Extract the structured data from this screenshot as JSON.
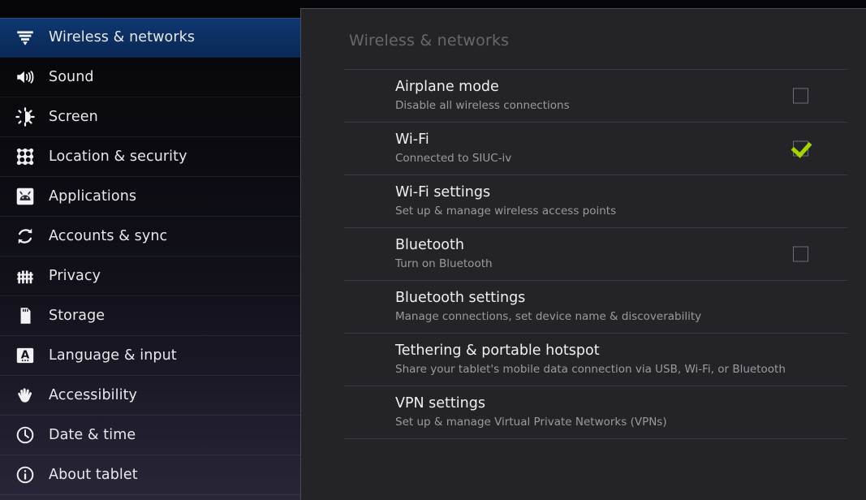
{
  "sidebar": {
    "items": [
      {
        "label": "Wireless & networks",
        "icon": "wireless-icon",
        "selected": true
      },
      {
        "label": "Sound",
        "icon": "sound-icon",
        "selected": false
      },
      {
        "label": "Screen",
        "icon": "screen-brightness-icon",
        "selected": false
      },
      {
        "label": "Location & security",
        "icon": "pattern-lock-icon",
        "selected": false
      },
      {
        "label": "Applications",
        "icon": "android-applications-icon",
        "selected": false
      },
      {
        "label": "Accounts & sync",
        "icon": "sync-icon",
        "selected": false
      },
      {
        "label": "Privacy",
        "icon": "fence-privacy-icon",
        "selected": false
      },
      {
        "label": "Storage",
        "icon": "sdcard-storage-icon",
        "selected": false
      },
      {
        "label": "Language & input",
        "icon": "keyboard-letter-a-icon",
        "selected": false
      },
      {
        "label": "Accessibility",
        "icon": "hand-icon",
        "selected": false
      },
      {
        "label": "Date & time",
        "icon": "clock-icon",
        "selected": false
      },
      {
        "label": "About tablet",
        "icon": "info-circle-icon",
        "selected": false
      }
    ]
  },
  "panel": {
    "title": "Wireless & networks",
    "rows": [
      {
        "title": "Airplane mode",
        "subtitle": "Disable all wireless connections",
        "control": "checkbox",
        "checked": false
      },
      {
        "title": "Wi-Fi",
        "subtitle": "Connected to SIUC-iv",
        "control": "checkbox",
        "checked": true
      },
      {
        "title": "Wi-Fi settings",
        "subtitle": "Set up & manage wireless access points",
        "control": "none",
        "checked": false
      },
      {
        "title": "Bluetooth",
        "subtitle": "Turn on Bluetooth",
        "control": "checkbox",
        "checked": false
      },
      {
        "title": "Bluetooth settings",
        "subtitle": "Manage connections, set device name & discoverability",
        "control": "none",
        "checked": false
      },
      {
        "title": "Tethering & portable hotspot",
        "subtitle": "Share your tablet's mobile data connection via USB, Wi-Fi, or Bluetooth",
        "control": "none",
        "checked": false
      },
      {
        "title": "VPN settings",
        "subtitle": "Set up & manage Virtual Private Networks (VPNs)",
        "control": "none",
        "checked": false
      }
    ]
  },
  "colors": {
    "selected_blue": "#0d3470",
    "checkmark_green": "#a6d400",
    "panel_background": "#232328",
    "sidebar_background": "#0a0a10",
    "title_gray": "#68686c"
  }
}
